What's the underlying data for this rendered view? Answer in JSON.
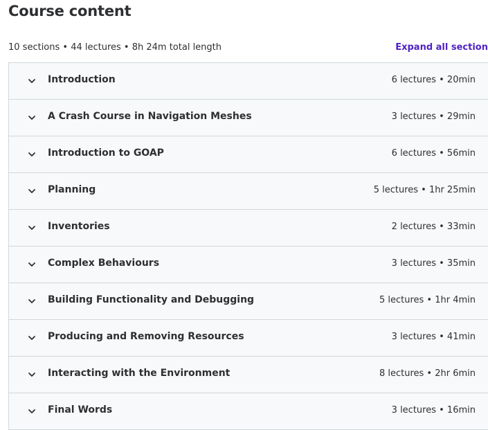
{
  "header": {
    "title": "Course content",
    "summary": "10 sections • 44 lectures • 8h 24m total length",
    "expand_all_label": "Expand all section"
  },
  "sections": [
    {
      "title": "Introduction",
      "meta": "6 lectures • 20min"
    },
    {
      "title": "A Crash Course in Navigation Meshes",
      "meta": "3 lectures • 29min"
    },
    {
      "title": "Introduction to GOAP",
      "meta": "6 lectures • 56min"
    },
    {
      "title": "Planning",
      "meta": "5 lectures • 1hr 25min"
    },
    {
      "title": "Inventories",
      "meta": "2 lectures • 33min"
    },
    {
      "title": "Complex Behaviours",
      "meta": "3 lectures • 35min"
    },
    {
      "title": "Building Functionality and Debugging",
      "meta": "5 lectures • 1hr 4min"
    },
    {
      "title": "Producing and Removing Resources",
      "meta": "3 lectures • 41min"
    },
    {
      "title": "Interacting with the Environment",
      "meta": "8 lectures • 2hr 6min"
    },
    {
      "title": "Final Words",
      "meta": "3 lectures • 16min"
    }
  ],
  "icons": {
    "section_toggle": "chevron-down-icon"
  },
  "colors": {
    "text": "#2d2f31",
    "link": "#5022c3",
    "section_bg": "#f7f9fa",
    "border": "#d1d7dc"
  }
}
